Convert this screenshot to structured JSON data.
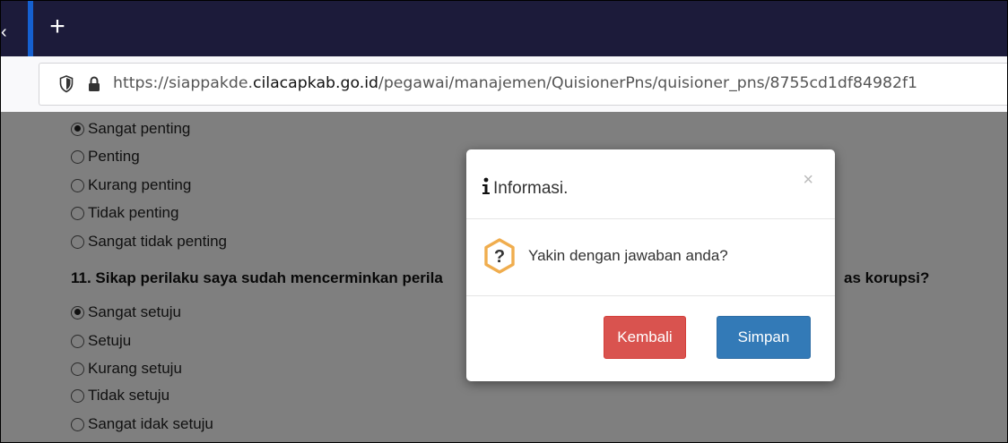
{
  "browser": {
    "new_tab_glyph": "+",
    "tab_edge_glyph": "‹",
    "url": {
      "prefix": "https://siappakde.",
      "host": "cilacapkab.go.id",
      "path": "/pegawai/manajemen/QuisionerPns/quisioner_pns/8755cd1df84982f1"
    }
  },
  "page": {
    "question10_options": [
      {
        "label": "Sangat penting",
        "selected": true
      },
      {
        "label": "Penting",
        "selected": false
      },
      {
        "label": "Kurang penting",
        "selected": false
      },
      {
        "label": "Tidak penting",
        "selected": false
      },
      {
        "label": "Sangat tidak penting",
        "selected": false
      }
    ],
    "question11_visible_start": "11. Sikap perilaku saya sudah mencerminkan perila",
    "question11_visible_end": "as korupsi?",
    "question11_options": [
      {
        "label": "Sangat setuju",
        "selected": true
      },
      {
        "label": "Setuju",
        "selected": false
      },
      {
        "label": "Kurang setuju",
        "selected": false
      },
      {
        "label": "Tidak setuju",
        "selected": false
      },
      {
        "label": "Sangat idak setuju",
        "selected": false
      }
    ]
  },
  "modal": {
    "title": "Informasi.",
    "close_glyph": "×",
    "message": "Yakin dengan jawaban anda?",
    "cancel_label": "Kembali",
    "confirm_label": "Simpan"
  },
  "colors": {
    "tab_strip": "#1c1b3a",
    "danger": "#d9534f",
    "primary": "#337ab7",
    "warning_icon": "#f0ad4e"
  }
}
